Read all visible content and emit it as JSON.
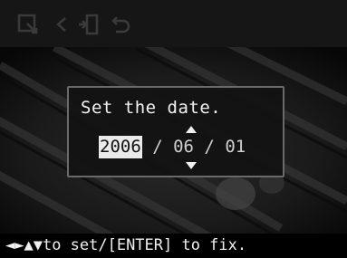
{
  "toolbar": {
    "icons": [
      "zoom-icon",
      "left-arrow-icon",
      "rotate-icon",
      "undo-icon"
    ]
  },
  "dialog": {
    "title": "Set the date.",
    "year": "2006",
    "separator1": " / ",
    "month": "06",
    "separator2": " / ",
    "day": "01"
  },
  "footer": {
    "arrows": "◄►▲▼",
    "instruction": "to set/[ENTER] to fix."
  },
  "colors": {
    "toolbar_bg": "#161616",
    "icon_disabled": "#3a3a3a",
    "dialog_border": "#6a6a6a",
    "selected_bg": "#eaeaea"
  }
}
